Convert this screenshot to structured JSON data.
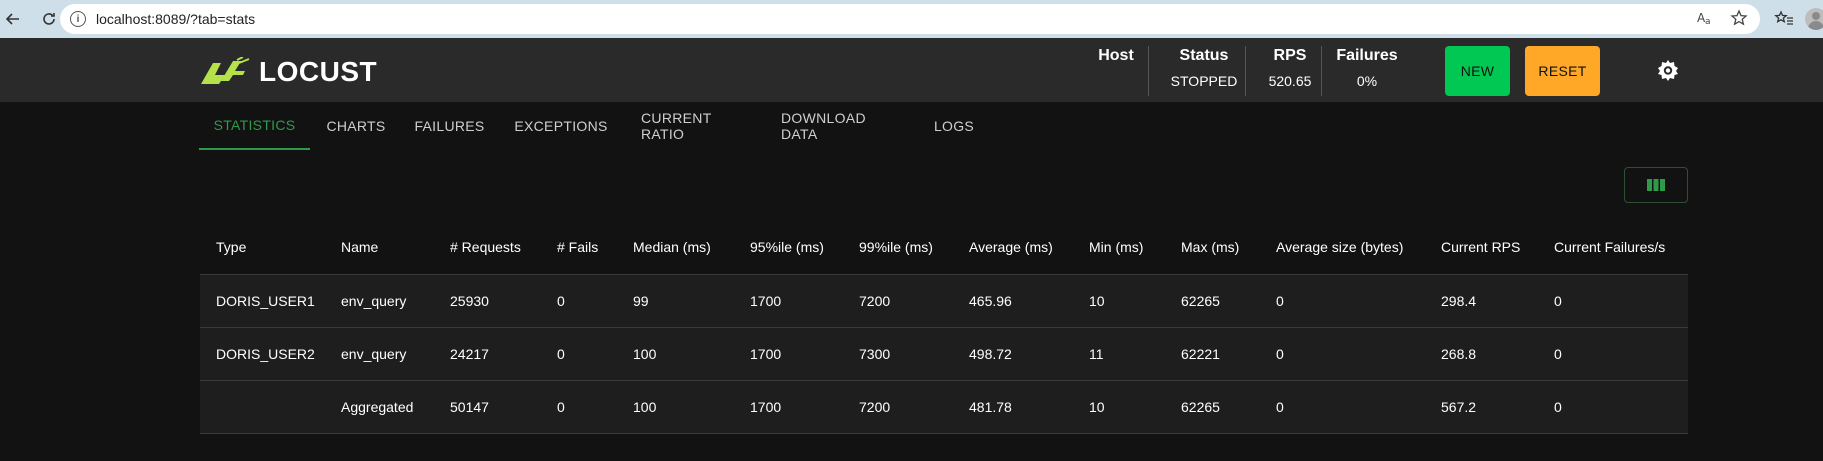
{
  "browser": {
    "url": "localhost:8089/?tab=stats",
    "info_glyph": "i"
  },
  "header": {
    "logo_text": "LOCUST",
    "host_label": "Host",
    "status_label": "Status",
    "status_value": "STOPPED",
    "rps_label": "RPS",
    "rps_value": "520.65",
    "failures_label": "Failures",
    "failures_value": "0%",
    "new_label": "NEW",
    "reset_label": "RESET"
  },
  "tabs": [
    {
      "label": "STATISTICS",
      "active": true
    },
    {
      "label": "CHARTS"
    },
    {
      "label": "FAILURES"
    },
    {
      "label": "EXCEPTIONS"
    },
    {
      "label": "CURRENT RATIO"
    },
    {
      "label": "DOWNLOAD DATA"
    },
    {
      "label": "LOGS"
    }
  ],
  "table": {
    "columns": [
      "Type",
      "Name",
      "# Requests",
      "# Fails",
      "Median (ms)",
      "95%ile (ms)",
      "99%ile (ms)",
      "Average (ms)",
      "Min (ms)",
      "Max (ms)",
      "Average size (bytes)",
      "Current RPS",
      "Current Failures/s"
    ],
    "rows": [
      [
        "DORIS_USER1",
        "env_query",
        "25930",
        "0",
        "99",
        "1700",
        "7200",
        "465.96",
        "10",
        "62265",
        "0",
        "298.4",
        "0"
      ],
      [
        "DORIS_USER2",
        "env_query",
        "24217",
        "0",
        "100",
        "1700",
        "7300",
        "498.72",
        "11",
        "62221",
        "0",
        "268.8",
        "0"
      ],
      [
        "",
        "Aggregated",
        "50147",
        "0",
        "100",
        "1700",
        "7200",
        "481.78",
        "10",
        "62265",
        "0",
        "567.2",
        "0"
      ]
    ]
  },
  "colors": {
    "accent_green": "#2e9a4a",
    "new_button": "#00c853",
    "reset_button": "#ffa726",
    "header_bg": "#2a2a2a",
    "page_bg": "#121212"
  },
  "icons": {
    "back": "arrow-left-icon",
    "reload": "reload-icon",
    "translate": "translate-icon",
    "star": "star-icon",
    "favorites": "favorites-icon",
    "profile": "profile-icon",
    "logo": "locust-logo-icon",
    "gear": "gear-icon",
    "columns": "columns-icon"
  }
}
